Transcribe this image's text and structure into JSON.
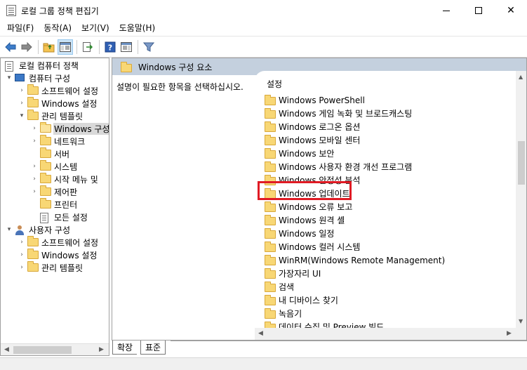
{
  "window": {
    "title": "로컬 그룹 정책 편집기",
    "minimize": "",
    "maximize": "",
    "close": "✕"
  },
  "menu": [
    "파일(F)",
    "동작(A)",
    "보기(V)",
    "도움말(H)"
  ],
  "tree": [
    {
      "label": "로컬 컴퓨터 정책",
      "indent": 0,
      "icon": "doc",
      "expander": ""
    },
    {
      "label": "컴퓨터 구성",
      "indent": 1,
      "icon": "pc",
      "expander": "▾"
    },
    {
      "label": "소프트웨어 설정",
      "indent": 2,
      "icon": "folder",
      "expander": "›"
    },
    {
      "label": "Windows 설정",
      "indent": 2,
      "icon": "folder",
      "expander": "›"
    },
    {
      "label": "관리 템플릿",
      "indent": 2,
      "icon": "folder",
      "expander": "▾"
    },
    {
      "label": "Windows 구성",
      "indent": 3,
      "icon": "folder-open",
      "expander": "›",
      "selected": true
    },
    {
      "label": "네트워크",
      "indent": 3,
      "icon": "folder",
      "expander": "›"
    },
    {
      "label": "서버",
      "indent": 3,
      "icon": "folder",
      "expander": ""
    },
    {
      "label": "시스템",
      "indent": 3,
      "icon": "folder",
      "expander": "›"
    },
    {
      "label": "시작 메뉴 및",
      "indent": 3,
      "icon": "folder",
      "expander": "›"
    },
    {
      "label": "제어판",
      "indent": 3,
      "icon": "folder",
      "expander": "›"
    },
    {
      "label": "프린터",
      "indent": 3,
      "icon": "folder",
      "expander": ""
    },
    {
      "label": "모든 설정",
      "indent": 3,
      "icon": "settings",
      "expander": ""
    },
    {
      "label": "사용자 구성",
      "indent": 1,
      "icon": "user",
      "expander": "▾"
    },
    {
      "label": "소프트웨어 설정",
      "indent": 2,
      "icon": "folder",
      "expander": "›"
    },
    {
      "label": "Windows 설정",
      "indent": 2,
      "icon": "folder",
      "expander": "›"
    },
    {
      "label": "관리 템플릿",
      "indent": 2,
      "icon": "folder",
      "expander": "›"
    }
  ],
  "right": {
    "header_title": "Windows 구성 요소",
    "description": "설명이 필요한 항목을 선택하십시오.",
    "column_header": "설정",
    "items": [
      "Windows PowerShell",
      "Windows 게임 녹화 및 브로드캐스팅",
      "Windows 로그온 옵션",
      "Windows 모바일 센터",
      "Windows 보안",
      "Windows 사용자 환경 개선 프로그램",
      "Windows 안정성 분석",
      "Windows 업데이트",
      "Windows 오류 보고",
      "Windows 원격 셸",
      "Windows 일정",
      "Windows 컬러 시스템",
      "WinRM(Windows Remote Management)",
      "가장자리 UI",
      "검색",
      "내 디바이스 찾기",
      "녹음기",
      "데이터 수집 및 Preview 빌드"
    ],
    "highlighted_item": "Windows 업데이트"
  },
  "tabs": {
    "extended": "확장",
    "standard": "표준"
  },
  "colors": {
    "header_bg": "#c4d0de",
    "highlight": "#e01b24",
    "folder": "#f8d775"
  }
}
